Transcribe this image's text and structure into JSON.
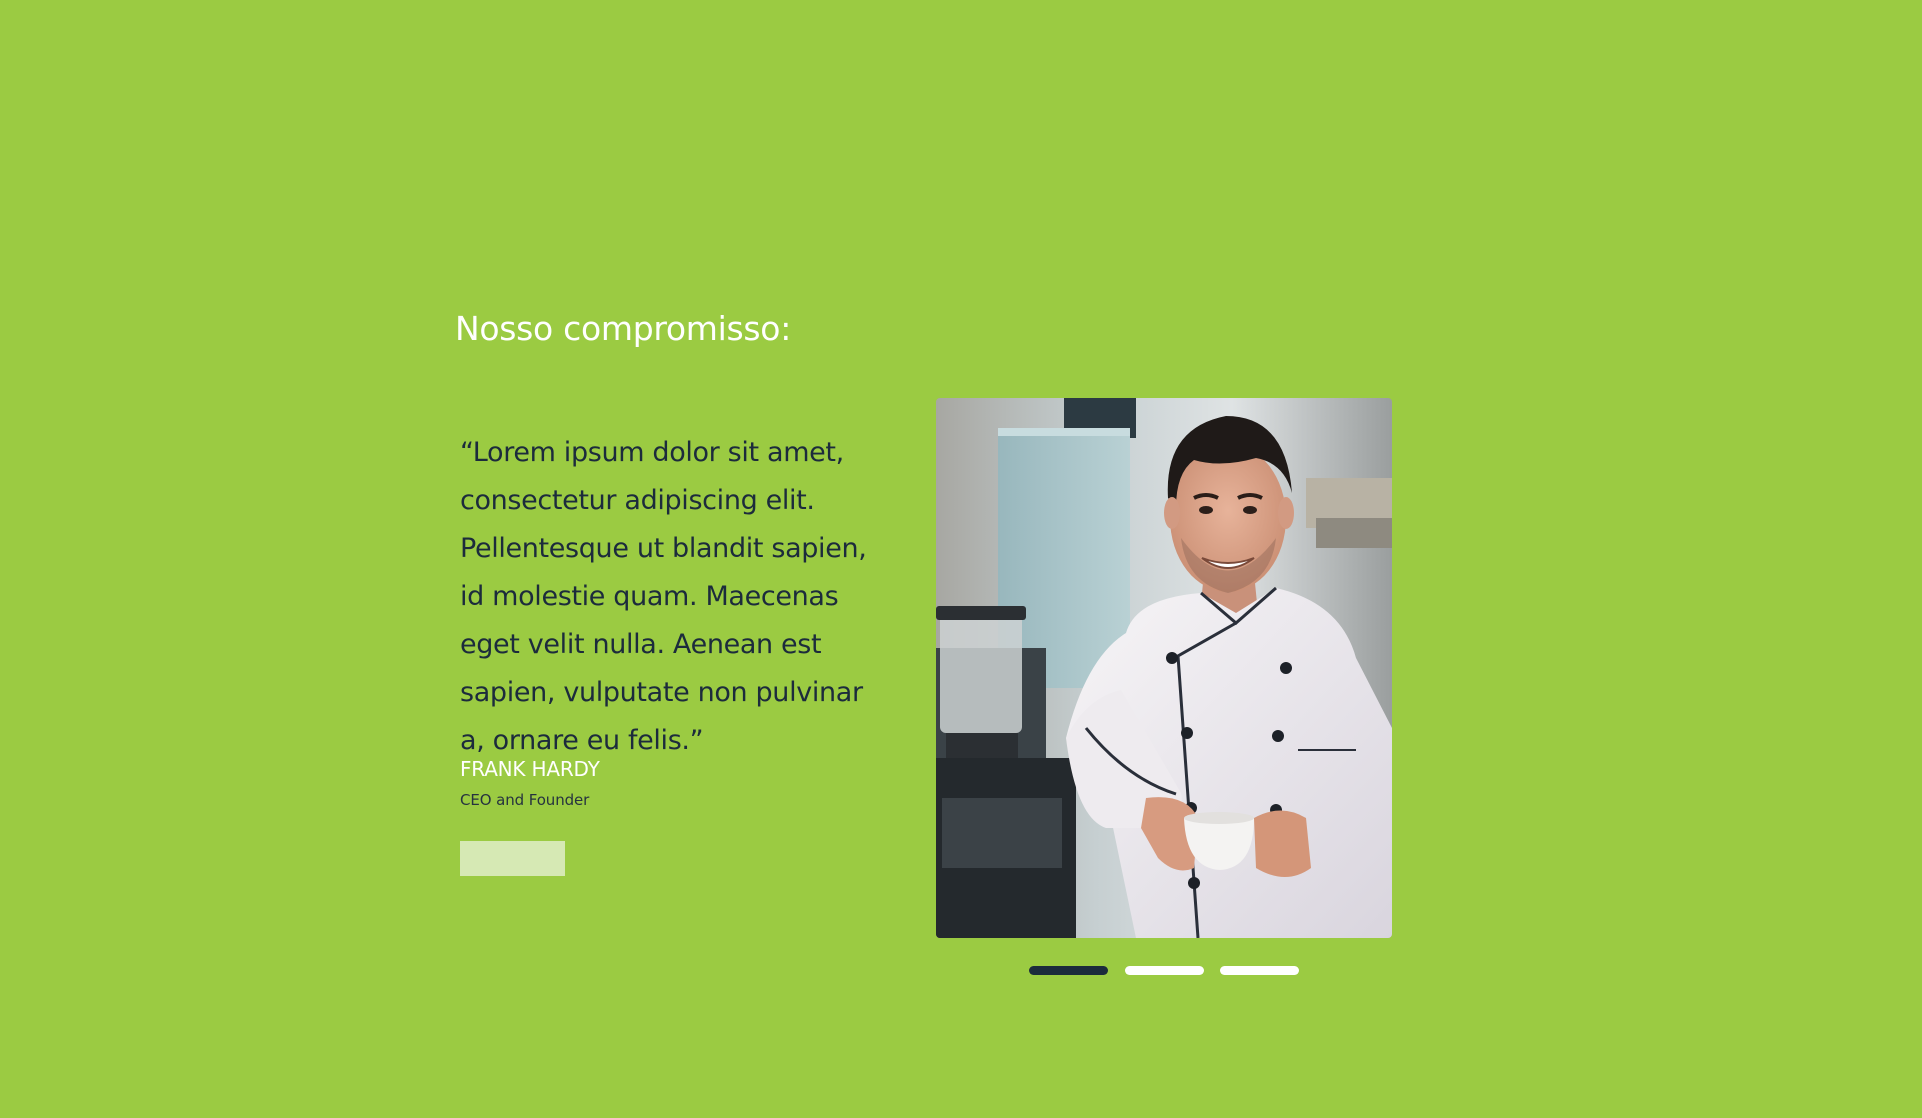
{
  "section": {
    "title": "Nosso compromisso:"
  },
  "testimonial": {
    "quote": "“Lorem ipsum dolor sit amet, consectetur adipiscing elit. Pellentesque ut blandit sapien, id molestie quam. Maecenas eget velit nulla. Aenean est sapien, vulputate non pulvinar a, ornare eu felis.”",
    "author": "FRANK HARDY",
    "role": "CEO and Founder",
    "button_label": ""
  },
  "carousel": {
    "slide_count": 3,
    "active_index": 0
  },
  "colors": {
    "background": "#9bcb42",
    "quote_text": "#1c2b3c",
    "dot_active": "#1c2b3c",
    "dot_inactive": "#ffffff",
    "button_bg": "#d6e9b4"
  }
}
